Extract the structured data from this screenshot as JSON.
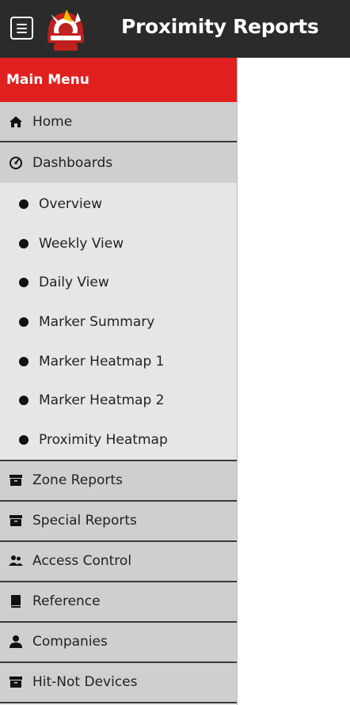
{
  "header": {
    "title": "Proximity Reports",
    "menu_icon": "hamburger-menu-icon",
    "logo": "hit-not-logo"
  },
  "sidebar": {
    "heading": "Main Menu",
    "items": [
      {
        "label": "Home",
        "icon": "home-icon"
      },
      {
        "label": "Dashboards",
        "icon": "dashboard-icon"
      }
    ],
    "dashboard_items": [
      {
        "label": "Overview"
      },
      {
        "label": "Weekly View"
      },
      {
        "label": "Daily View"
      },
      {
        "label": "Marker Summary"
      },
      {
        "label": "Marker Heatmap 1"
      },
      {
        "label": "Marker Heatmap 2"
      },
      {
        "label": "Proximity Heatmap"
      }
    ],
    "bottom_items": [
      {
        "label": "Zone Reports",
        "icon": "archive-box-icon"
      },
      {
        "label": "Special Reports",
        "icon": "archive-box-icon"
      },
      {
        "label": "Access Control",
        "icon": "users-icon"
      },
      {
        "label": "Reference",
        "icon": "book-icon"
      },
      {
        "label": "Companies",
        "icon": "user-icon"
      },
      {
        "label": "Hit-Not Devices",
        "icon": "archive-box-icon"
      }
    ]
  },
  "colors": {
    "topbar": "#2b2b2b",
    "menu_header": "#e0201f",
    "menu_item": "#cfcfcf",
    "submenu": "#e6e6e6"
  }
}
